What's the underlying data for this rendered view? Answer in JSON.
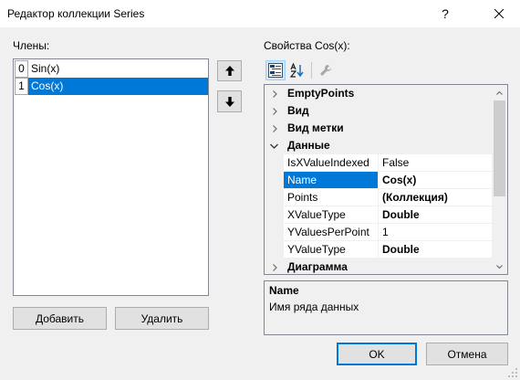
{
  "window": {
    "title": "Редактор коллекции Series",
    "help_label": "?"
  },
  "members": {
    "label": "Члены:",
    "items": [
      {
        "index": "0",
        "name": "Sin(x)",
        "selected": false
      },
      {
        "index": "1",
        "name": "Cos(x)",
        "selected": true
      }
    ],
    "add_label": "Добавить",
    "remove_label": "Удалить"
  },
  "properties": {
    "label": "Свойства Cos(x):",
    "toolbar": {
      "categorized_active": true,
      "alphabetical_active": false,
      "property_pages_enabled": false
    },
    "categories": [
      {
        "label": "EmptyPoints",
        "expanded": false
      },
      {
        "label": "Вид",
        "expanded": false
      },
      {
        "label": "Вид метки",
        "expanded": false
      },
      {
        "label": "Данные",
        "expanded": true,
        "properties": [
          {
            "name": "IsXValueIndexed",
            "value": "False",
            "non_default": false,
            "selected": false
          },
          {
            "name": "Name",
            "value": "Cos(x)",
            "non_default": true,
            "selected": true
          },
          {
            "name": "Points",
            "value": "(Коллекция)",
            "non_default": true,
            "selected": false
          },
          {
            "name": "XValueType",
            "value": "Double",
            "non_default": true,
            "selected": false
          },
          {
            "name": "YValuesPerPoint",
            "value": "1",
            "non_default": false,
            "selected": false
          },
          {
            "name": "YValueType",
            "value": "Double",
            "non_default": true,
            "selected": false
          }
        ]
      },
      {
        "label": "Диаграмма",
        "expanded": false
      }
    ],
    "description": {
      "title": "Name",
      "text": "Имя ряда данных"
    }
  },
  "dialog": {
    "ok_label": "OK",
    "cancel_label": "Отмена"
  },
  "icons": {
    "close": "close-icon",
    "move_up": "arrow-up-icon",
    "move_down": "arrow-down-icon",
    "categorized": "categorized-icon",
    "alphabetical": "alphabetical-sort-icon",
    "property_pages": "wrench-icon",
    "collapsed": "chevron-right-icon",
    "expanded": "chevron-down-icon",
    "scroll_up": "scroll-up-arrow-icon",
    "scroll_down": "scroll-down-arrow-icon",
    "resize_grip": "resize-grip-icon"
  },
  "colors": {
    "title_bar": "#FFFFFF",
    "window": "#F0F0F0",
    "selection": "#0078D7",
    "selection_text": "#FFFFFF",
    "default_button_border": "#0078D7",
    "toolbar_active": "#CCE8FF"
  }
}
